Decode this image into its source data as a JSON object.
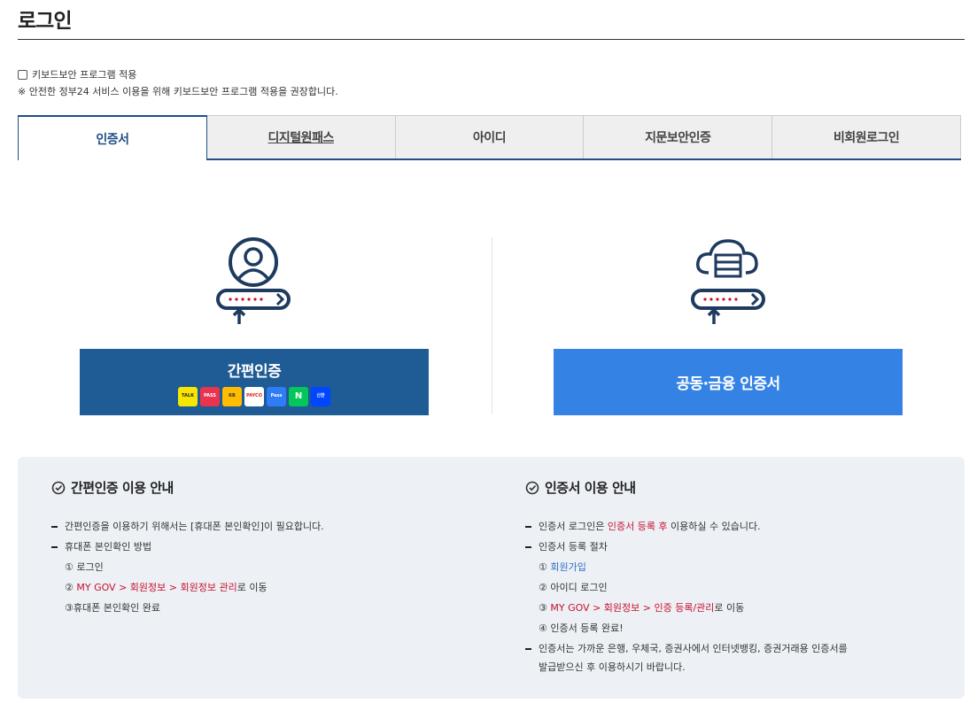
{
  "page": {
    "title": "로그인"
  },
  "keyboard": {
    "checkbox_label": "키보드보안 프로그램 적용",
    "note": "※ 안전한 정부24 서비스 이용을 위해 키보드보안 프로그램 적용을 권장합니다."
  },
  "tabs": [
    {
      "label": "인증서",
      "active": true
    },
    {
      "label": "디지털원패스",
      "active": false
    },
    {
      "label": "아이디",
      "active": false
    },
    {
      "label": "지문보안인증",
      "active": false
    },
    {
      "label": "비회원로그인",
      "active": false
    }
  ],
  "login": {
    "simple_button": "간편인증",
    "cert_button": "공동·금융 인증서",
    "simple_logos": [
      "TALK",
      "PASS",
      "KB",
      "PAYCO",
      "Pass",
      "N",
      "신한"
    ]
  },
  "guide": {
    "simple": {
      "title": "간편인증 이용 안내",
      "item1": "간편인증을 이용하기 위해서는 [휴대폰 본인확인]이 필요합니다.",
      "item2": "휴대폰 본인확인 방법",
      "step1": "① 로그인",
      "step2_prefix": "② ",
      "step2_link": "MY GOV > 회원정보 > 회원정보 관리",
      "step2_suffix": "로 이동",
      "step3": "③휴대폰 본인확인 완료"
    },
    "cert": {
      "title": "인증서 이용 안내",
      "item1_prefix": "인증서 로그인은 ",
      "item1_highlight": "인증서 등록 후",
      "item1_suffix": " 이용하실 수 있습니다.",
      "item2": "인증서 등록 절차",
      "step1_prefix": "① ",
      "step1_link": "회원가입",
      "step2": "② 아이디 로그인",
      "step3_prefix": "③ ",
      "step3_link": "MY GOV > 회원정보 > 인증 등록/관리",
      "step3_suffix": "로 이동",
      "step4": "④ 인증서 등록 완료!",
      "item3_line1": "인증서는 가까운 은행, 우체국, 증권사에서 인터넷뱅킹, 증권거래용 인증서를",
      "item3_line2": "발급받으신 후 이용하시기 바랍니다."
    }
  },
  "colors": {
    "navy": "#1f5b95",
    "blue": "#3482e4",
    "accent_red": "#c8102e"
  }
}
